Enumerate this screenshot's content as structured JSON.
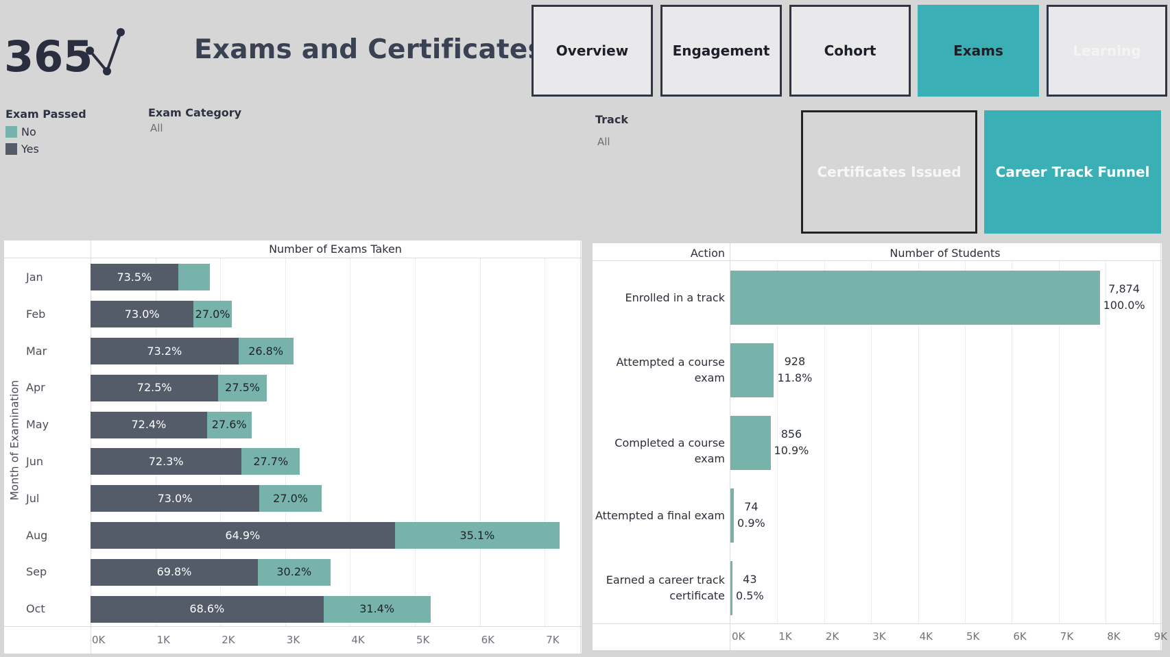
{
  "logo": {
    "text": "365"
  },
  "title": "Exams and Certificates",
  "nav": [
    {
      "label": "Overview",
      "state": "default"
    },
    {
      "label": "Engagement",
      "state": "default"
    },
    {
      "label": "Cohort",
      "state": "default"
    },
    {
      "label": "Exams",
      "state": "active"
    },
    {
      "label": "Learning",
      "state": "faded"
    }
  ],
  "filters": {
    "exam_passed": {
      "title": "Exam Passed",
      "items": [
        {
          "label": "No",
          "color": "#77b3ab"
        },
        {
          "label": "Yes",
          "color": "#545b69"
        }
      ]
    },
    "exam_category": {
      "title": "Exam Category",
      "value": "All"
    },
    "track": {
      "title": "Track",
      "value": "All"
    }
  },
  "buttons": {
    "certificates_issued": "Certificates Issued",
    "career_track_funnel": "Career Track Funnel"
  },
  "colors": {
    "accent": "#3aafb6",
    "no": "#77b3ab",
    "yes": "#545b69",
    "background": "#d6d6d6"
  },
  "chart_data": [
    {
      "type": "bar",
      "orientation": "horizontal",
      "stacked": true,
      "title": "Number of Exams Taken",
      "ylabel": "Month of Examination",
      "categories": [
        "Jan",
        "Feb",
        "Mar",
        "Apr",
        "May",
        "Jun",
        "Jul",
        "Aug",
        "Sep",
        "Oct"
      ],
      "series": [
        {
          "name": "Yes",
          "values": [
            1350,
            1590,
            2280,
            1970,
            1795,
            2330,
            2600,
            4690,
            2580,
            3590
          ],
          "labels": [
            "73.5%",
            "73.0%",
            "73.2%",
            "72.5%",
            "72.4%",
            "72.3%",
            "73.0%",
            "64.9%",
            "69.8%",
            "68.6%"
          ]
        },
        {
          "name": "No",
          "values": [
            485,
            585,
            845,
            745,
            685,
            895,
            965,
            2540,
            1115,
            1650
          ],
          "labels": [
            "",
            "27.0%",
            "26.8%",
            "27.5%",
            "27.6%",
            "27.7%",
            "27.0%",
            "35.1%",
            "30.2%",
            "31.4%"
          ]
        }
      ],
      "xlim": [
        0,
        7500
      ],
      "xticks": [
        "0K",
        "1K",
        "2K",
        "3K",
        "4K",
        "5K",
        "6K",
        "7K"
      ],
      "xtick_values": [
        0,
        1000,
        2000,
        3000,
        4000,
        5000,
        6000,
        7000
      ],
      "grid": true
    },
    {
      "type": "bar",
      "orientation": "horizontal",
      "title": "Number of Students",
      "ylabel": "Action",
      "categories": [
        "Enrolled in a track",
        "Attempted a course exam",
        "Completed a course exam",
        "Attempted a final exam",
        "Earned a career track certificate"
      ],
      "category_lines": [
        [
          "Enrolled in a track"
        ],
        [
          "Attempted a course",
          "exam"
        ],
        [
          "Completed a course exam"
        ],
        [
          "Attempted a final exam"
        ],
        [
          "Earned a career track",
          "certificate"
        ]
      ],
      "values": [
        7874,
        928,
        856,
        74,
        43
      ],
      "value_labels": [
        "7,874",
        "928",
        "856",
        "74",
        "43"
      ],
      "percent_labels": [
        "100.0%",
        "11.8%",
        "10.9%",
        "0.9%",
        "0.5%"
      ],
      "xlim": [
        0,
        9300
      ],
      "xticks": [
        "0K",
        "1K",
        "2K",
        "3K",
        "4K",
        "5K",
        "6K",
        "7K",
        "8K",
        "9K"
      ],
      "xtick_values": [
        0,
        1000,
        2000,
        3000,
        4000,
        5000,
        6000,
        7000,
        8000,
        9000
      ],
      "grid": true
    }
  ]
}
